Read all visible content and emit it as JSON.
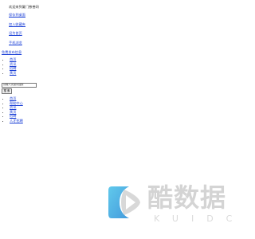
{
  "header": {
    "welcome": "欢迎来到厦门慈善网"
  },
  "topnav": [
    {
      "label": "保存到桌面"
    },
    {
      "label": "加入收藏夹"
    },
    {
      "label": "设为首页"
    },
    {
      "label": "手机浏览"
    }
  ],
  "free_post": {
    "label": "免费发布信息"
  },
  "menu1": [
    {
      "label": "首页"
    },
    {
      "label": "资讯"
    },
    {
      "label": "招聘"
    },
    {
      "label": "黄页"
    }
  ],
  "search": {
    "placeholder": "请输入关键词搜索",
    "button_label": "搜 索"
  },
  "menu2": [
    {
      "label": "首页"
    },
    {
      "label": "帮助中心"
    },
    {
      "label": "资讯"
    },
    {
      "label": "黄页"
    },
    {
      "label": "招聘"
    },
    {
      "label": "人才招聘"
    }
  ],
  "watermark": {
    "title": "酷数据",
    "subtitle": "KUIDC",
    "icon": "play-logo-icon",
    "colors": {
      "blue": "#5ab4e8",
      "grey": "#d4d4d4"
    }
  }
}
